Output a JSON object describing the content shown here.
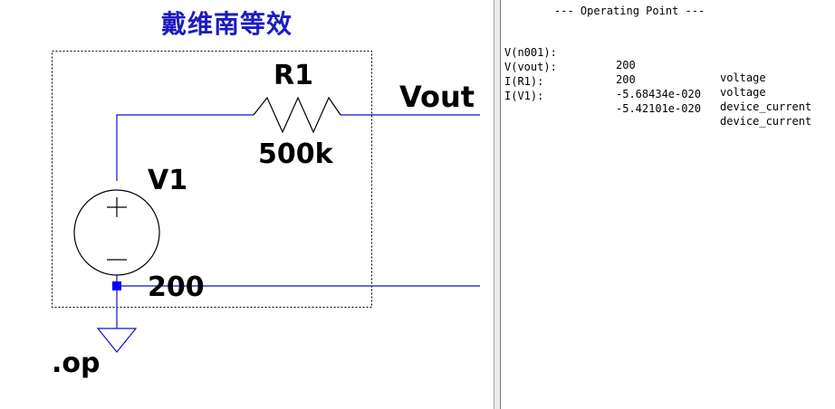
{
  "schematic": {
    "title": "戴维南等效",
    "resistor": {
      "name": "R1",
      "value": "500k"
    },
    "source": {
      "name": "V1",
      "value": "200"
    },
    "net_label": "Vout",
    "directive": ".op",
    "colors": {
      "wire": "#1010c8",
      "title": "#1c1cbf",
      "node": "#0000ff"
    }
  },
  "output": {
    "header": "--- Operating Point ---",
    "rows": [
      {
        "name": "V(n001):",
        "value": "200",
        "type": "voltage"
      },
      {
        "name": "V(vout):",
        "value": "200",
        "type": "voltage"
      },
      {
        "name": "I(R1):",
        "value": "-5.68434e-020",
        "type": "device_current"
      },
      {
        "name": "I(V1):",
        "value": "-5.42101e-020",
        "type": "device_current"
      }
    ]
  }
}
